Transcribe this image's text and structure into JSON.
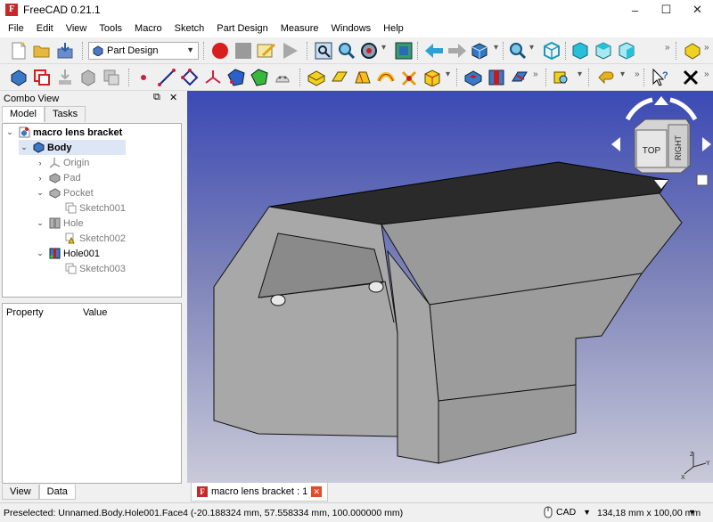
{
  "window": {
    "title": "FreeCAD 0.21.1",
    "controls": [
      "–",
      "☐",
      "✕"
    ]
  },
  "menu": [
    "File",
    "Edit",
    "View",
    "Tools",
    "Macro",
    "Sketch",
    "Part Design",
    "Measure",
    "Windows",
    "Help"
  ],
  "toolbar": {
    "workbench": "Part Design",
    "more": "»"
  },
  "combo_view": {
    "title": "Combo View",
    "float_glyph": "⧉",
    "close_glyph": "✕",
    "tabs": [
      "Model",
      "Tasks"
    ],
    "tree": [
      {
        "label": "macro lens bracket",
        "level": 0,
        "expander": "v",
        "bold": true,
        "icon": "document-icon"
      },
      {
        "label": "Body",
        "level": 1,
        "expander": "v",
        "bold": true,
        "selected": true,
        "icon": "body-icon"
      },
      {
        "label": "Origin",
        "level": 2,
        "expander": ">",
        "dim": true,
        "icon": "origin-icon"
      },
      {
        "label": "Pad",
        "level": 2,
        "expander": ">",
        "dim": true,
        "icon": "pad-icon"
      },
      {
        "label": "Pocket",
        "level": 2,
        "expander": "v",
        "dim": true,
        "icon": "pocket-icon"
      },
      {
        "label": "Sketch001",
        "level": 3,
        "dim": true,
        "icon": "sketch-icon"
      },
      {
        "label": "Hole",
        "level": 2,
        "expander": "v",
        "dim": true,
        "icon": "hole-icon"
      },
      {
        "label": "Sketch002",
        "level": 3,
        "dim": true,
        "icon": "sketch-warn-icon"
      },
      {
        "label": "Hole001",
        "level": 2,
        "expander": "v",
        "icon": "hole-active-icon"
      },
      {
        "label": "Sketch003",
        "level": 3,
        "dim": true,
        "icon": "sketch-icon"
      }
    ],
    "property_headers": [
      "Property",
      "Value"
    ],
    "bottom_tabs": [
      "View",
      "Data"
    ]
  },
  "navcube": {
    "top": "TOP",
    "right": "RIGHT"
  },
  "axis": {
    "x": "X",
    "y": "Y",
    "z": "Z"
  },
  "document_tab": {
    "label": "macro lens bracket : 1",
    "close": "✕"
  },
  "status": {
    "message": "Preselected: Unnamed.Body.Hole001.Face4 (-20.188324 mm, 57.558334 mm, 100.000000 mm)",
    "nav_style": "CAD",
    "dimensions": "134,18 mm x 100,00 mm"
  },
  "colors": {
    "viewport_top": "#3b4ab5",
    "viewport_bottom": "#c9cad9",
    "selection": "#dde6f5",
    "accent_red": "#e34a2a"
  }
}
